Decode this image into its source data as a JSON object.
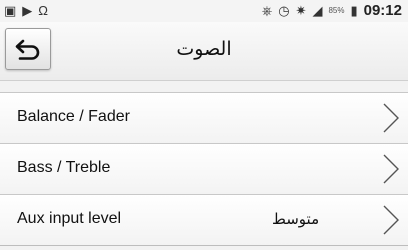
{
  "status_bar": {
    "left_icons": [
      "gallery-icon",
      "play-icon",
      "headphones-icon"
    ],
    "right_icons": [
      "no-signal-icon",
      "alarm-icon",
      "wifi-icon",
      "signal-icon",
      "battery-icon"
    ],
    "battery_percent": "85%",
    "time": "09:12"
  },
  "header": {
    "back_icon": "back-arrow-icon",
    "title": "الصوت"
  },
  "menu": {
    "items": [
      {
        "label": "Balance / Fader",
        "value": "",
        "icon": "chevron-right-icon"
      },
      {
        "label": "Bass / Treble",
        "value": "",
        "icon": "chevron-right-icon"
      },
      {
        "label": "Aux input level",
        "value": "متوسط",
        "icon": "chevron-right-icon"
      }
    ]
  }
}
